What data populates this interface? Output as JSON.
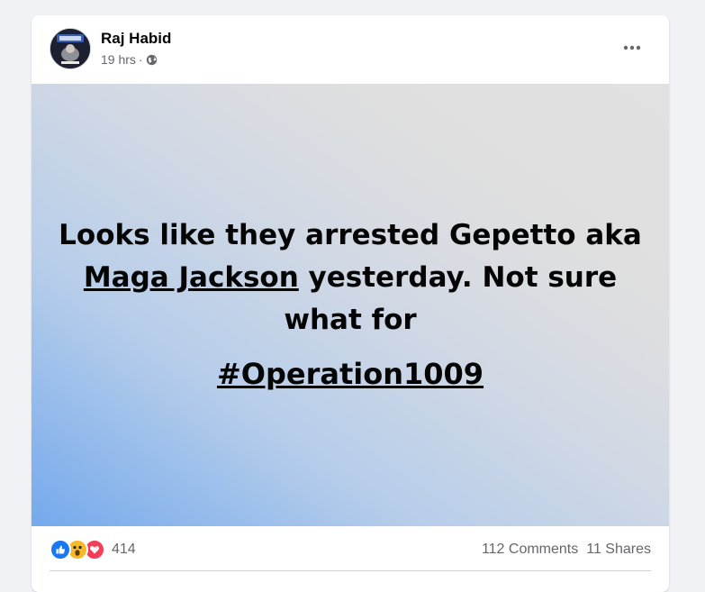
{
  "post": {
    "author": "Raj Habid",
    "time": "19 hrs",
    "separator": "·",
    "text_line1": "Looks like they arrested Gepetto aka",
    "text_link": "Maga Jackson",
    "text_line2_rest": " yesterday. Not sure",
    "text_line3": "what for",
    "hashtag": "#Operation1009",
    "reaction_count": "414",
    "comments": "112 Comments",
    "shares": "11 Shares"
  },
  "icons": {
    "globe": "globe-icon",
    "more": "more-options-icon",
    "like": "like-reaction-icon",
    "wow": "wow-reaction-icon",
    "love": "love-reaction-icon"
  },
  "colors": {
    "like_blue": "#1877f2",
    "wow_yellow": "#f7b928",
    "love_red": "#f33e58",
    "secondary_text": "#65676b"
  }
}
